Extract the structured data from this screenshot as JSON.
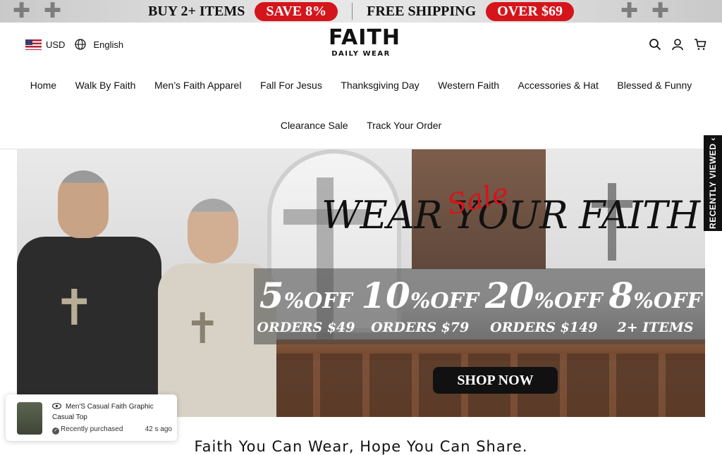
{
  "promo": {
    "left_text": "BUY 2+  ITEMS",
    "left_badge": "SAVE 8%",
    "right_text": "FREE SHIPPING",
    "right_badge": "OVER $69"
  },
  "header": {
    "currency": "USD",
    "language": "English",
    "logo_main": "FAITH",
    "logo_sub": "DAILY WEAR",
    "icons": [
      "search-icon",
      "account-icon",
      "cart-icon"
    ]
  },
  "nav": {
    "row1": [
      "Home",
      "Walk By Faith",
      "Men’s Faith Apparel",
      "Fall For Jesus",
      "Thanksgiving Day",
      "Western Faith",
      "Accessories & Hat",
      "Blessed & Funny"
    ],
    "row2": [
      "Clearance Sale",
      "Track Your Order"
    ]
  },
  "hero": {
    "headline_left": "WEAR",
    "headline_script": "Sale",
    "headline_mid": "YOUR",
    "headline_right": "FAITH",
    "offers": [
      {
        "pct": "5",
        "unit": "%OFF",
        "condition": "ORDERS $49"
      },
      {
        "pct": "10",
        "unit": "%OFF",
        "condition": "ORDERS $79"
      },
      {
        "pct": "20",
        "unit": "%OFF",
        "condition": "ORDERS $149"
      },
      {
        "pct": "8",
        "unit": "%OFF",
        "condition": "2+ ITEMS"
      }
    ],
    "cta": "SHOP NOW"
  },
  "recently_viewed": {
    "label": "RECENTLY VIEWED"
  },
  "popup": {
    "product": "Men'S Casual Faith Graphic Casual Top",
    "status": "Recently purchased",
    "time": "42 s ago"
  },
  "tagline": "Faith You Can Wear, Hope You Can Share.",
  "colors": {
    "accent_red": "#d4151b",
    "text": "#111111"
  }
}
